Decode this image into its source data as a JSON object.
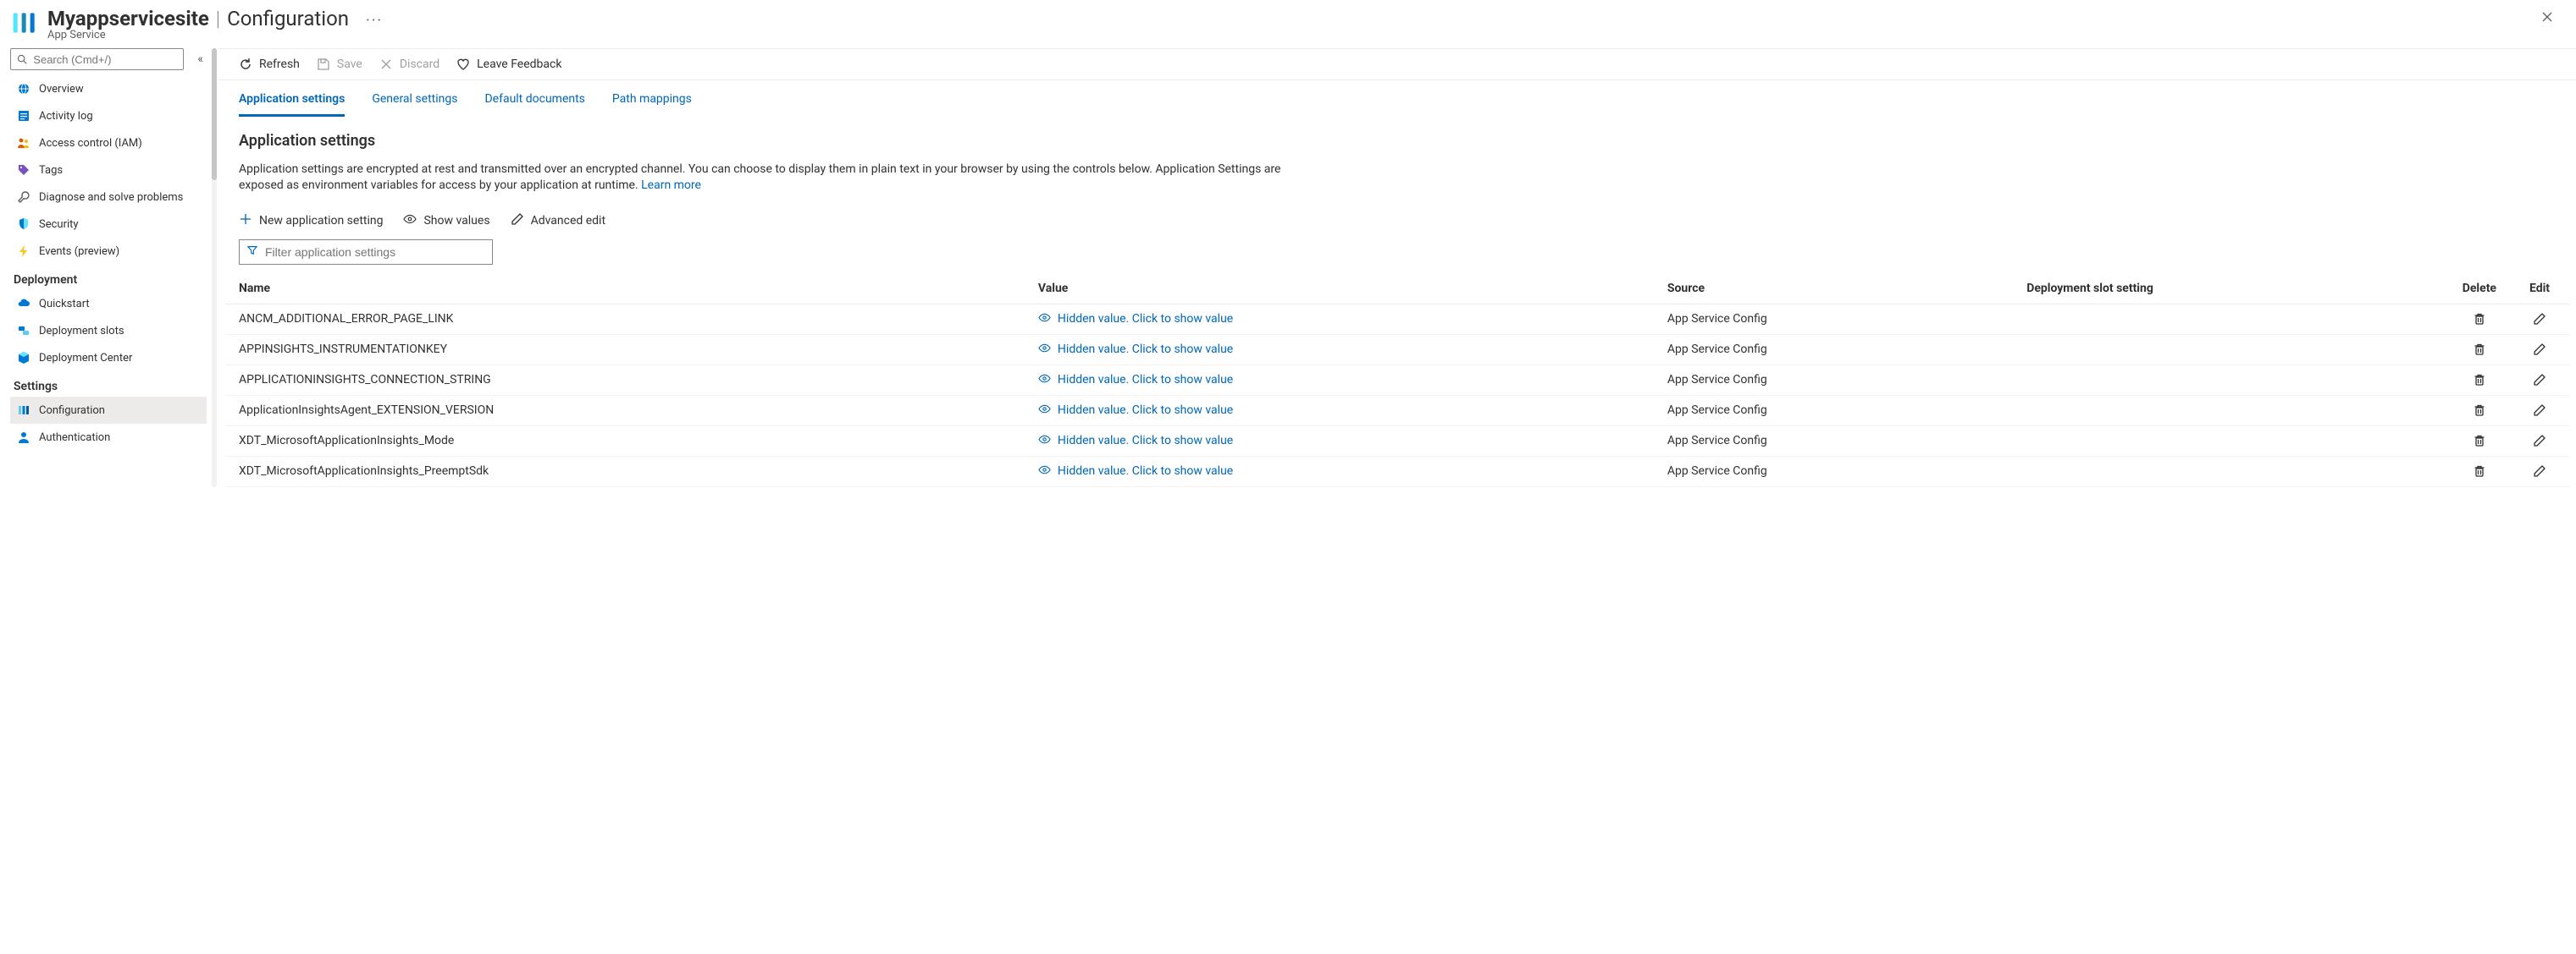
{
  "header": {
    "resource_name": "Myappservicesite",
    "section": "Configuration",
    "resource_type": "App Service"
  },
  "sidebar": {
    "search_placeholder": "Search (Cmd+/)",
    "items": [
      {
        "label": "Overview",
        "icon": "globe"
      },
      {
        "label": "Activity log",
        "icon": "log"
      },
      {
        "label": "Access control (IAM)",
        "icon": "people"
      },
      {
        "label": "Tags",
        "icon": "tag"
      },
      {
        "label": "Diagnose and solve problems",
        "icon": "wrench"
      },
      {
        "label": "Security",
        "icon": "shield"
      },
      {
        "label": "Events (preview)",
        "icon": "bolt"
      }
    ],
    "groups": [
      {
        "title": "Deployment",
        "items": [
          {
            "label": "Quickstart",
            "icon": "cloud"
          },
          {
            "label": "Deployment slots",
            "icon": "slots"
          },
          {
            "label": "Deployment Center",
            "icon": "cube"
          }
        ]
      },
      {
        "title": "Settings",
        "items": [
          {
            "label": "Configuration",
            "icon": "bars",
            "active": true
          },
          {
            "label": "Authentication",
            "icon": "person"
          }
        ]
      }
    ]
  },
  "commands": {
    "refresh": "Refresh",
    "save": "Save",
    "discard": "Discard",
    "feedback": "Leave Feedback"
  },
  "tabs": [
    {
      "label": "Application settings",
      "selected": true
    },
    {
      "label": "General settings"
    },
    {
      "label": "Default documents"
    },
    {
      "label": "Path mappings"
    }
  ],
  "appSettings": {
    "heading": "Application settings",
    "description": "Application settings are encrypted at rest and transmitted over an encrypted channel. You can choose to display them in plain text in your browser by using the controls below. Application Settings are exposed as environment variables for access by your application at runtime. ",
    "learn_more": "Learn more",
    "toolbar": {
      "new": "New application setting",
      "show_values": "Show values",
      "advanced_edit": "Advanced edit"
    },
    "filter_placeholder": "Filter application settings",
    "columns": {
      "name": "Name",
      "value": "Value",
      "source": "Source",
      "slot": "Deployment slot setting",
      "delete": "Delete",
      "edit": "Edit"
    },
    "hidden_text": "Hidden value. Click to show value",
    "rows": [
      {
        "name": "ANCM_ADDITIONAL_ERROR_PAGE_LINK",
        "source": "App Service Config"
      },
      {
        "name": "APPINSIGHTS_INSTRUMENTATIONKEY",
        "source": "App Service Config"
      },
      {
        "name": "APPLICATIONINSIGHTS_CONNECTION_STRING",
        "source": "App Service Config"
      },
      {
        "name": "ApplicationInsightsAgent_EXTENSION_VERSION",
        "source": "App Service Config"
      },
      {
        "name": "XDT_MicrosoftApplicationInsights_Mode",
        "source": "App Service Config"
      },
      {
        "name": "XDT_MicrosoftApplicationInsights_PreemptSdk",
        "source": "App Service Config"
      }
    ]
  }
}
